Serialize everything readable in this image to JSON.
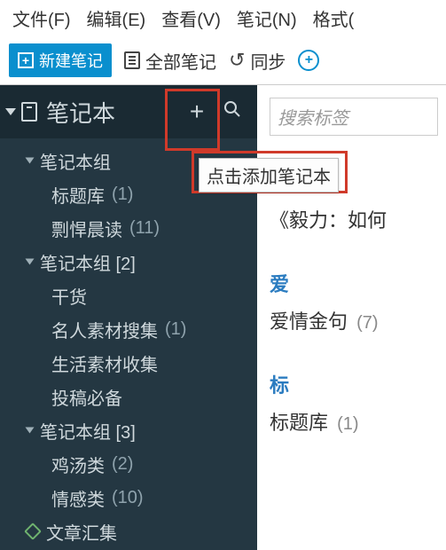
{
  "menu": {
    "file": "文件(F)",
    "edit": "编辑(E)",
    "view": "查看(V)",
    "note": "笔记(N)",
    "format": "格式("
  },
  "toolbar": {
    "new_note_label": "新建笔记",
    "all_notes_label": "全部笔记",
    "sync_label": "同步"
  },
  "sidebar": {
    "header_title": "笔记本",
    "groups": [
      {
        "label": "笔记本组",
        "children": [
          {
            "label": "标题库",
            "count": "(1)"
          },
          {
            "label": "剽悍晨读",
            "count": "(11)"
          }
        ]
      },
      {
        "label": "笔记本组 [2]",
        "children": [
          {
            "label": "干货",
            "count": ""
          },
          {
            "label": "名人素材搜集",
            "count": "(1)"
          },
          {
            "label": "生活素材收集",
            "count": ""
          },
          {
            "label": "投稿必备",
            "count": ""
          }
        ]
      },
      {
        "label": "笔记本组 [3]",
        "children": [
          {
            "label": "鸡汤类",
            "count": "(2)"
          },
          {
            "label": "情感类",
            "count": "(10)"
          }
        ]
      }
    ],
    "pinned_label": "文章汇集"
  },
  "main": {
    "search_placeholder": "搜索标签",
    "open_glyph": "《",
    "book_title": "《毅力：如何",
    "sections": [
      {
        "heading": "爱",
        "item_label": "爱情金句",
        "item_count": "(7)"
      },
      {
        "heading": "标",
        "item_label": "标题库",
        "item_count": "(1)"
      }
    ]
  },
  "tooltip_text": "点击添加笔记本"
}
